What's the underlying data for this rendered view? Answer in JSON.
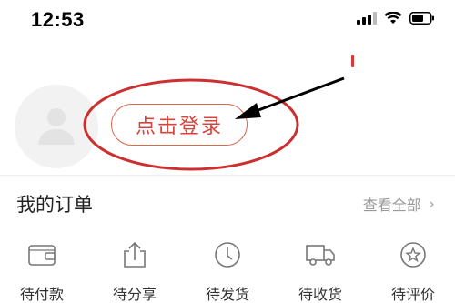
{
  "status_bar": {
    "time": "12:53",
    "icons": [
      "cellular-signal-icon",
      "wifi-icon",
      "battery-icon"
    ]
  },
  "profile": {
    "avatar_icon": "default-avatar-icon",
    "login_label": "点击登录"
  },
  "orders": {
    "title": "我的订单",
    "view_all": "查看全部",
    "items": [
      {
        "label": "待付款",
        "icon": "wallet-icon"
      },
      {
        "label": "待分享",
        "icon": "share-icon"
      },
      {
        "label": "待发货",
        "icon": "clock-icon"
      },
      {
        "label": "待收货",
        "icon": "truck-icon"
      },
      {
        "label": "待评价",
        "icon": "review-star-icon"
      }
    ]
  },
  "colors": {
    "accent": "#d6453a",
    "annotation": "#cc2f2f",
    "muted": "#999999"
  }
}
